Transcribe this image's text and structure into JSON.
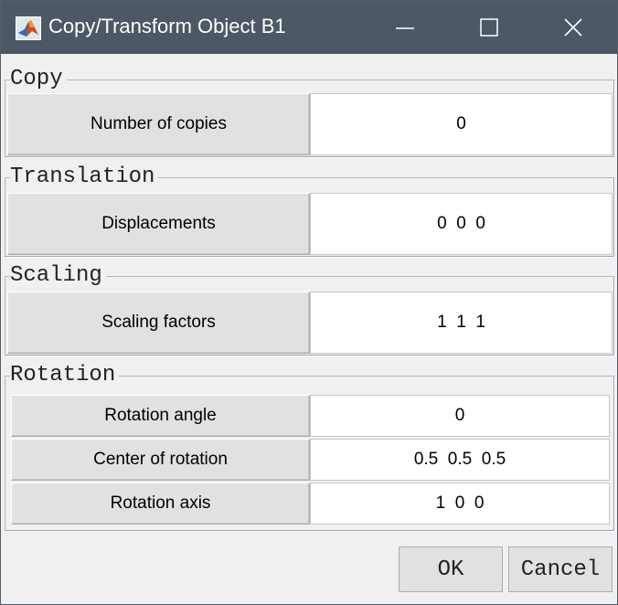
{
  "window": {
    "title": "Copy/Transform Object B1",
    "colors": {
      "titlebar": "#4c5865",
      "background": "#f0f0f0"
    }
  },
  "groups": {
    "copy": {
      "title": "Copy",
      "rows": [
        {
          "label": "Number of copies",
          "value": "0"
        }
      ]
    },
    "translation": {
      "title": "Translation",
      "rows": [
        {
          "label": "Displacements",
          "value": "0  0  0"
        }
      ]
    },
    "scaling": {
      "title": "Scaling",
      "rows": [
        {
          "label": "Scaling factors",
          "value": "1  1  1"
        }
      ]
    },
    "rotation": {
      "title": "Rotation",
      "rows": [
        {
          "label": "Rotation angle",
          "value": "0"
        },
        {
          "label": "Center of rotation",
          "value": "0.5  0.5  0.5"
        },
        {
          "label": "Rotation axis",
          "value": "1  0  0"
        }
      ]
    }
  },
  "buttons": {
    "ok": "OK",
    "cancel": "Cancel"
  },
  "icons": {
    "app": "matlab-icon",
    "minimize": "minimize-icon",
    "maximize": "maximize-icon",
    "close": "close-icon"
  }
}
